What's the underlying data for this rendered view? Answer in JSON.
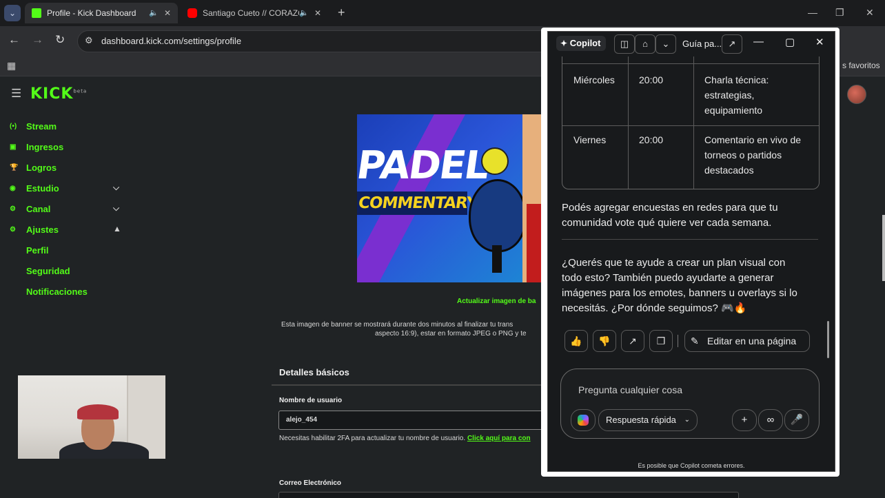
{
  "browser": {
    "tabs": [
      {
        "title": "Profile - Kick Dashboard",
        "active": true,
        "favicon_color": "#53fc18"
      },
      {
        "title": "Santiago Cueto // CORAZÓ",
        "active": false,
        "favicon_color": "#ff0000"
      }
    ],
    "url": "dashboard.kick.com/settings/profile",
    "bookmarks_label": "s favoritos"
  },
  "kick": {
    "logo": "KICK",
    "nav": [
      {
        "label": "Stream",
        "icon": "stream-icon"
      },
      {
        "label": "Ingresos",
        "icon": "revenue-icon"
      },
      {
        "label": "Logros",
        "icon": "trophy-icon"
      },
      {
        "label": "Estudio",
        "icon": "studio-icon",
        "expandable": true
      },
      {
        "label": "Canal",
        "icon": "channel-icon",
        "expandable": true
      },
      {
        "label": "Ajustes",
        "icon": "gear-icon",
        "expanded": true
      }
    ],
    "subnav": [
      {
        "label": "Perfil"
      },
      {
        "label": "Seguridad"
      },
      {
        "label": "Notificaciones"
      }
    ],
    "banner": {
      "line1": "PADEL",
      "line2": "COMMENTARY"
    },
    "update_banner_link": "Actualizar imagen de ba",
    "banner_help_line1": "Esta imagen de banner se mostrará durante dos minutos al finalizar tu trans",
    "banner_help_line2": "aspecto 16:9), estar en formato JPEG o PNG y te",
    "section_title": "Detalles básicos",
    "username_label": "Nombre de usuario",
    "username_value": "alejo_454",
    "username_note": "Necesitas habilitar 2FA para actualizar tu nombre de usuario.",
    "username_note_link": "Click aquí para con",
    "email_label": "Correo Electrónico",
    "accent": "#53fc18"
  },
  "copilot": {
    "brand": "Copilot",
    "guide_title": "Guía pa...",
    "schedule": [
      {
        "day": "Miércoles",
        "time": "20:00",
        "topic": [
          "Charla técnica:",
          "estrategias,",
          "equipamiento"
        ]
      },
      {
        "day": "Viernes",
        "time": "20:00",
        "topic": [
          "Comentario en vivo de",
          "torneos o partidos",
          "destacados"
        ]
      }
    ],
    "para1": [
      "Podés agregar encuestas en redes para que tu",
      "comunidad vote qué quiere ver cada semana."
    ],
    "para2": [
      "¿Querés que te ayude a crear un plan visual con",
      "todo esto? También puedo ayudarte a generar",
      "imágenes para los emotes, banners u overlays si lo",
      "necesitás. ¿Por dónde seguimos? 🎮🔥"
    ],
    "edit_button": "Editar en una página",
    "composer_placeholder": "Pregunta cualquier cosa",
    "mode_label": "Respuesta rápida",
    "disclaimer": "Es posible que Copilot cometa errores."
  }
}
